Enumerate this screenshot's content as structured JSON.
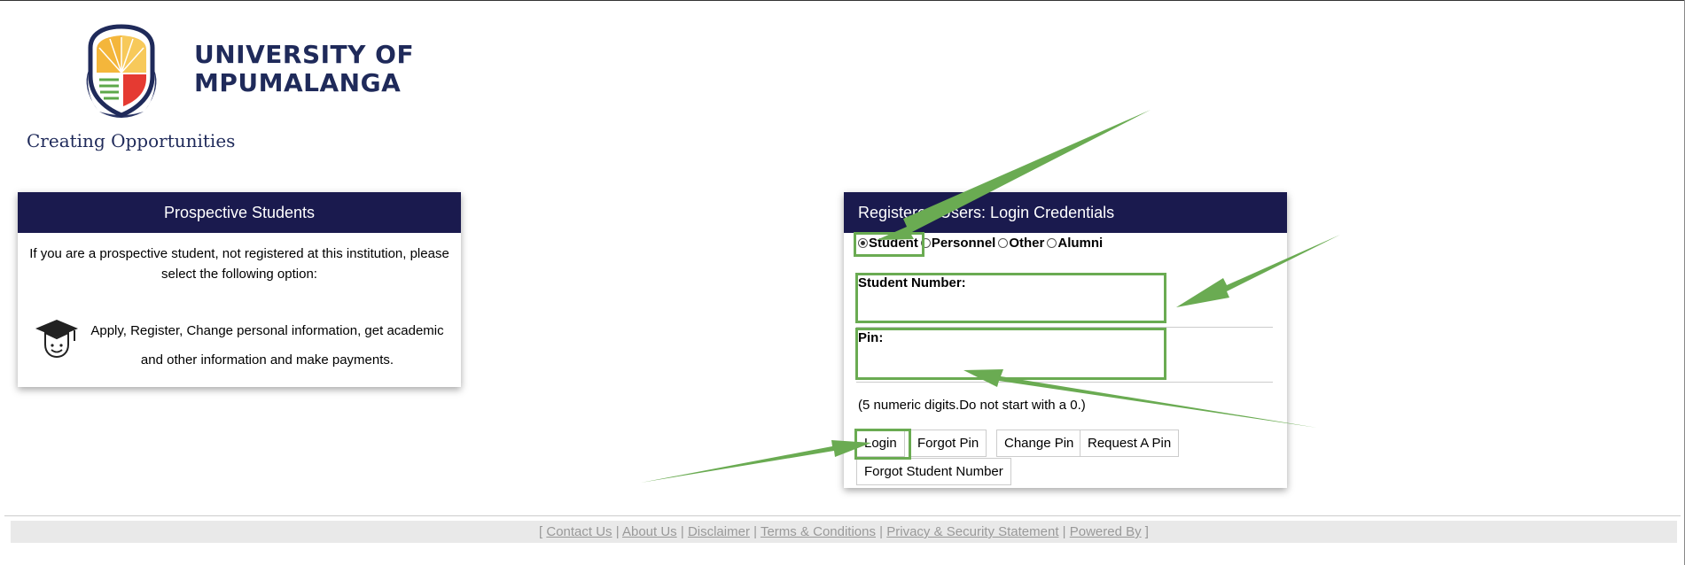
{
  "branding": {
    "logo": "university-crest",
    "name_line1": "UNIVERSITY OF",
    "name_line2": "MPUMALANGA",
    "tagline": "Creating Opportunities"
  },
  "prospective": {
    "title": "Prospective Students",
    "intro": "If you are a prospective student, not registered at this institution, please select the following option:",
    "option_icon": "graduation-cap-icon",
    "option_text": "Apply, Register, Change personal information, get academic and other information and make payments."
  },
  "login": {
    "title": "Registered Users: Login Credentials",
    "roles": [
      {
        "label": "Student",
        "selected": true
      },
      {
        "label": "Personnel",
        "selected": false
      },
      {
        "label": "Other",
        "selected": false
      },
      {
        "label": "Alumni",
        "selected": false
      }
    ],
    "student_number_label": "Student Number:",
    "student_number_value": "",
    "pin_label": "Pin:",
    "pin_value": "",
    "hint": "(5 numeric digits.Do not start with a 0.)",
    "buttons": {
      "login": "Login",
      "forgot_pin": "Forgot Pin",
      "change_pin": "Change Pin",
      "request_pin": "Request A Pin",
      "forgot_student_number": "Forgot Student Number"
    }
  },
  "footer": {
    "open": "[",
    "close": "]",
    "separator": "|",
    "links": [
      "Contact Us",
      "About Us",
      "Disclaimer",
      "Terms & Conditions",
      "Privacy & Security Statement",
      "Powered By"
    ]
  },
  "colors": {
    "header_bg": "#1a1a4e",
    "brand_navy": "#1f2a5a",
    "annotation_green": "#6aab52"
  }
}
